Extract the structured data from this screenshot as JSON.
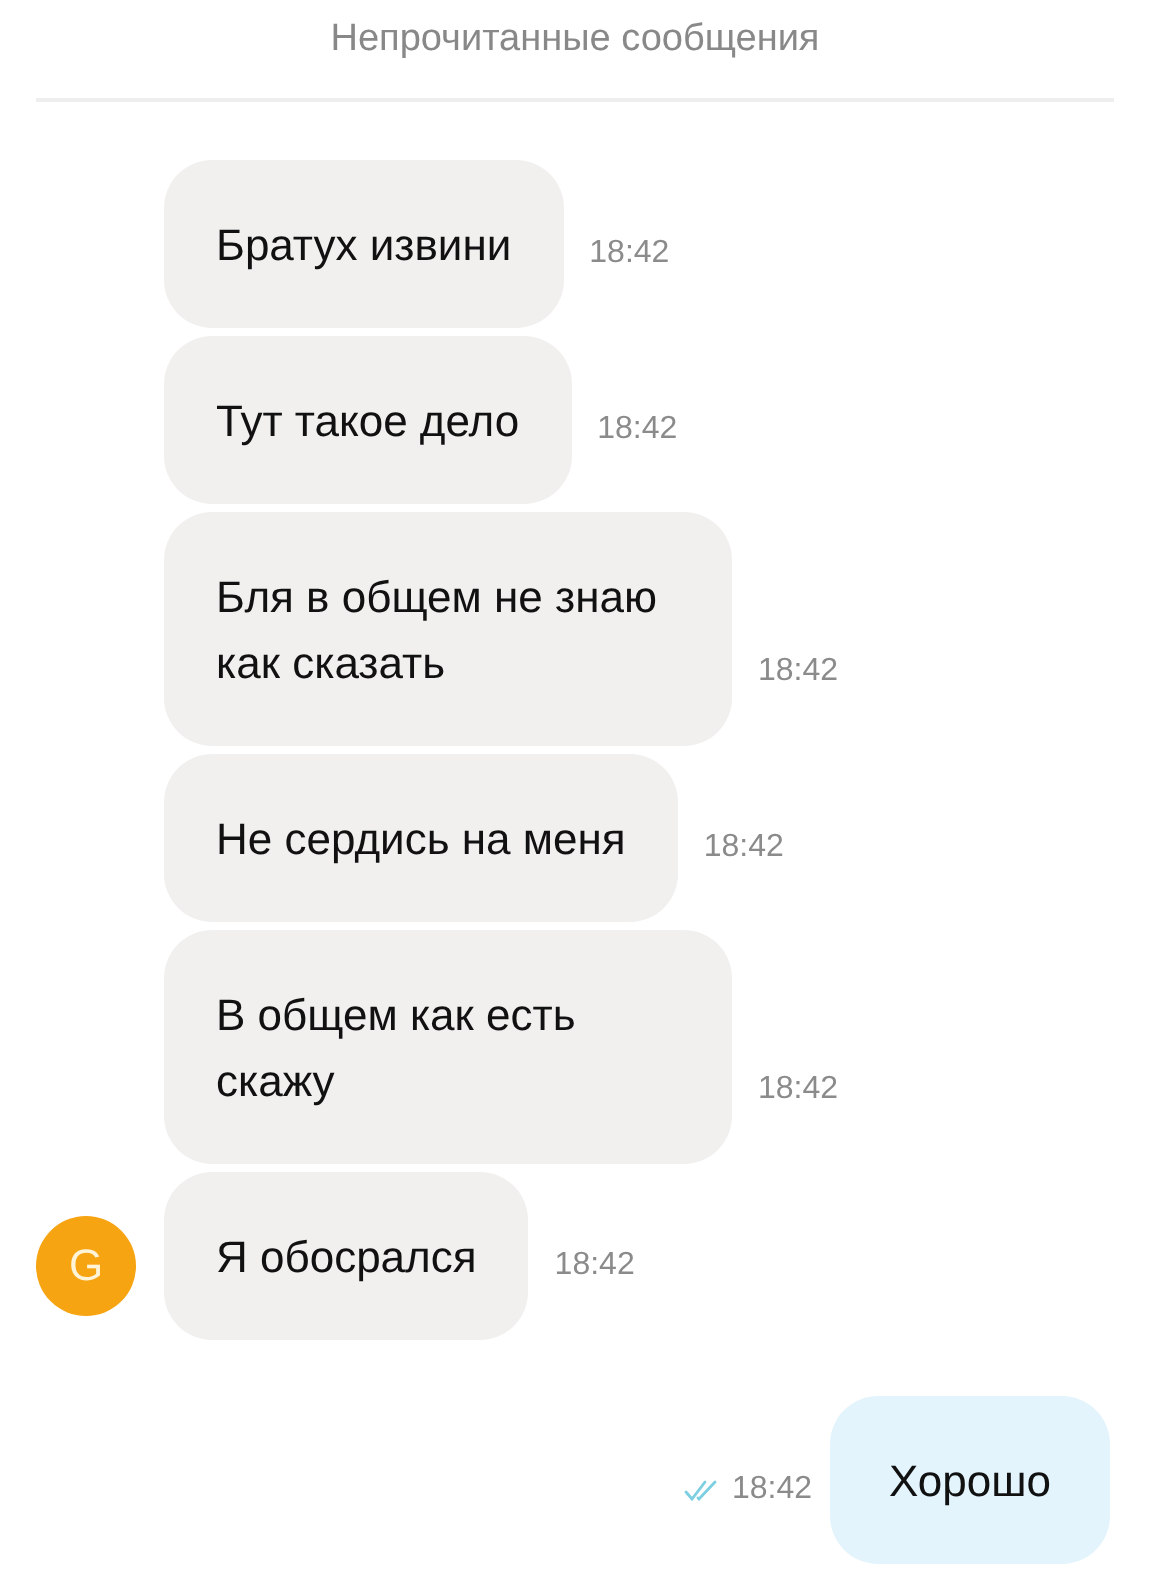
{
  "divider_label": "Непрочитанные сообщения",
  "incoming": [
    {
      "text": "Братух извини",
      "time": "18:42"
    },
    {
      "text": "Тут такое дело",
      "time": "18:42"
    },
    {
      "text": "Бля в общем не знаю как сказать",
      "time": "18:42"
    },
    {
      "text": "Не сердись на меня",
      "time": "18:42"
    },
    {
      "text": "В общем как есть скажу",
      "time": "18:42"
    },
    {
      "text": "Я обосрался",
      "time": "18:42",
      "avatar": "G"
    }
  ],
  "outgoing": [
    {
      "text": "Хорошо",
      "time": "18:42",
      "read": true
    }
  ]
}
